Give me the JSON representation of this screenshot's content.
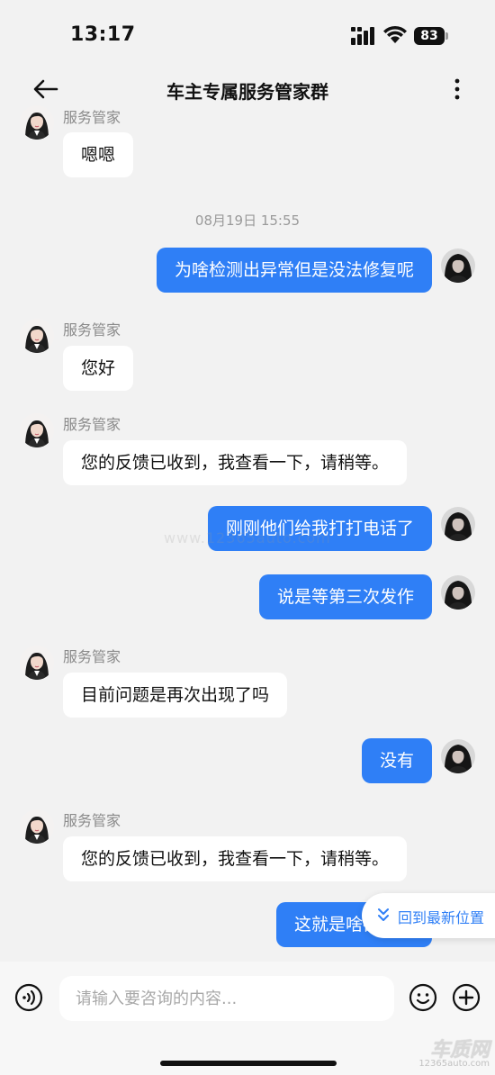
{
  "status_bar": {
    "time": "13:17",
    "battery": "83"
  },
  "header": {
    "title": "车主专属服务管家群"
  },
  "chat": {
    "agent_name": "服务管家",
    "messages": [
      {
        "side": "in",
        "show_name": true,
        "text": "嗯嗯"
      },
      {
        "type": "timestamp",
        "text": "08月19日 15:55"
      },
      {
        "side": "out",
        "text": "为啥检测出异常但是没法修复呢"
      },
      {
        "side": "in",
        "show_name": true,
        "text": "您好"
      },
      {
        "side": "in",
        "show_name": true,
        "text": "您的反馈已收到，我查看一下，请稍等。"
      },
      {
        "side": "out",
        "text": "刚刚他们给我打打电话了"
      },
      {
        "side": "out",
        "text": "说是等第三次发作"
      },
      {
        "side": "in",
        "show_name": true,
        "text": "目前问题是再次出现了吗"
      },
      {
        "side": "out",
        "text": "没有"
      },
      {
        "side": "in",
        "show_name": true,
        "text": "您的反馈已收到，我查看一下，请稍等。"
      },
      {
        "side": "out",
        "text": "这就是啥都不知"
      }
    ],
    "jump_to_latest": "回到最新位置"
  },
  "input_bar": {
    "placeholder": "请输入要咨询的内容..."
  },
  "watermark": {
    "mid_text": "www.12365auto.com",
    "logo_text": "车质网",
    "logo_sub": "12365auto.com"
  },
  "colors": {
    "accent": "#2f7ff6",
    "background": "#f2f2f2",
    "bubble_in": "#ffffff"
  }
}
